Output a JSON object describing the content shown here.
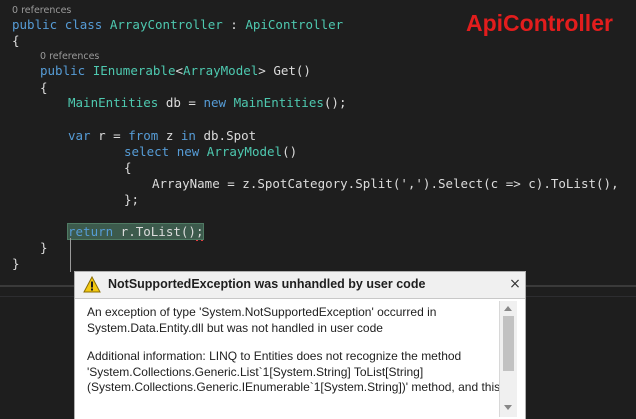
{
  "editor": {
    "codelens_1": "0 references",
    "codelens_2": "0 references",
    "watermark": "ApiController",
    "code": {
      "l1_kw1": "public",
      "l1_kw2": "class",
      "l1_name": "ArrayController",
      "l1_colon": " : ",
      "l1_base": "ApiController",
      "l2": "{",
      "l3_kw": "public",
      "l3_type": "IEnumerable",
      "l3_lt": "<",
      "l3_targ": "ArrayModel",
      "l3_rest": "> Get()",
      "l4": "{",
      "l5_type": "MainEntities",
      "l5_mid": " db = ",
      "l5_kw": "new",
      "l5_type2": "MainEntities",
      "l5_end": "();",
      "l6_kw": "var",
      "l6_mid": " r = ",
      "l6_kw2": "from",
      "l6_mid2": " z ",
      "l6_kw3": "in",
      "l6_end": " db.Spot",
      "l7_kw": "select",
      "l7_kw2": "new",
      "l7_type": "ArrayModel",
      "l7_end": "()",
      "l8": "{",
      "l9": "ArrayName = z.SpotCategory.Split(',').Select(c => c).ToList(),",
      "l10": "};",
      "l11_kw": "return",
      "l11_rest": " r.ToList()",
      "l11_semi": ";",
      "l12": "}",
      "l13": "}"
    }
  },
  "exception_dialog": {
    "title": "NotSupportedException was unhandled by user code",
    "close_glyph": "×",
    "message_lines": [
      "An exception of type 'System.NotSupportedException' occurred in",
      "System.Data.Entity.dll but was not handled in user code"
    ],
    "details_lines": [
      "Additional information: LINQ to Entities does not recognize the method",
      "'System.Collections.Generic.List`1[System.String] ToList[String]",
      "(System.Collections.Generic.IEnumerable`1[System.String])' method, and this"
    ],
    "colors": {
      "warning": "#f2c811",
      "header_bg": "#f0f0f0"
    }
  },
  "icons": {
    "warning": "warning-icon",
    "close": "close-icon"
  },
  "colors": {
    "editor_bg": "#1e1e1e",
    "keyword": "#569cd6",
    "type": "#4ec9b0",
    "watermark": "#e21d1d"
  }
}
